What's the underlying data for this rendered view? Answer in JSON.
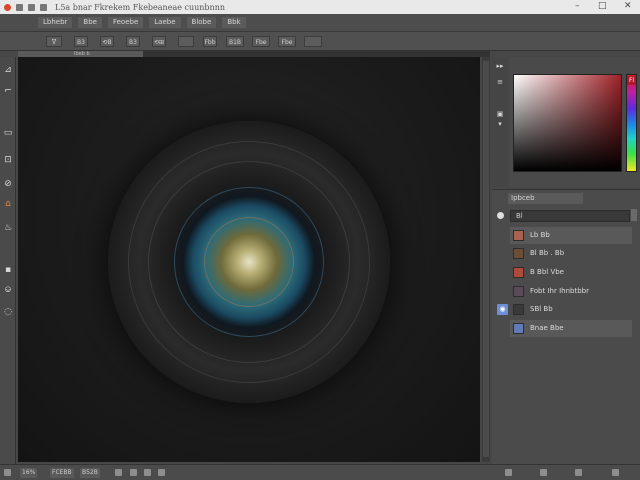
{
  "window": {
    "title": "L5a bnar Fkrekem Fkebeaneae cuunbnnn",
    "controls": [
      "–",
      "□",
      "✕"
    ]
  },
  "menu": [
    "Lbhebr",
    "Bbe",
    "Feoebe",
    "Laebe",
    "Blobe",
    "Bbk"
  ],
  "options": [
    "ᐁ",
    "B3",
    "⟲B",
    "B3",
    "⟲⊞",
    "",
    "Fbb",
    "B1B",
    "Fbe",
    "Fbe"
  ],
  "document_tab": "Ibeb b",
  "tools": [
    "⊿",
    "⌐",
    "",
    "▭",
    "⊡",
    "⊘",
    "⌂",
    "♨",
    "",
    "▪",
    "⎉",
    "◌"
  ],
  "color_panel": {
    "picker_base_hex": "#a02228",
    "hue_label": "Fl",
    "strip_icons": [
      "▸▸",
      "≡",
      "▣",
      "▾"
    ]
  },
  "layers_panel": {
    "tab": "Ipbceb",
    "filter_label": "Bl",
    "layers": [
      {
        "name": "Lb  Bb",
        "thumb": "#a9624f"
      },
      {
        "name": "Bl  Bb .  Bb",
        "thumb": "#6b4e34"
      },
      {
        "name": "B   Bbl  Vbe",
        "thumb": "#b04a3c"
      },
      {
        "name": "Fobt Ihr Ihnbtbbr",
        "thumb": "#5a4a5a"
      },
      {
        "name": "SBl  Bb",
        "thumb": "#3a3a3a"
      },
      {
        "name": "Bnae  Bbe",
        "thumb": "#607bb8"
      }
    ],
    "eye_icons": [
      "◉",
      "◧"
    ]
  },
  "status": {
    "zoom": "16%",
    "doc": "FCEBB",
    "size": "B52B"
  }
}
